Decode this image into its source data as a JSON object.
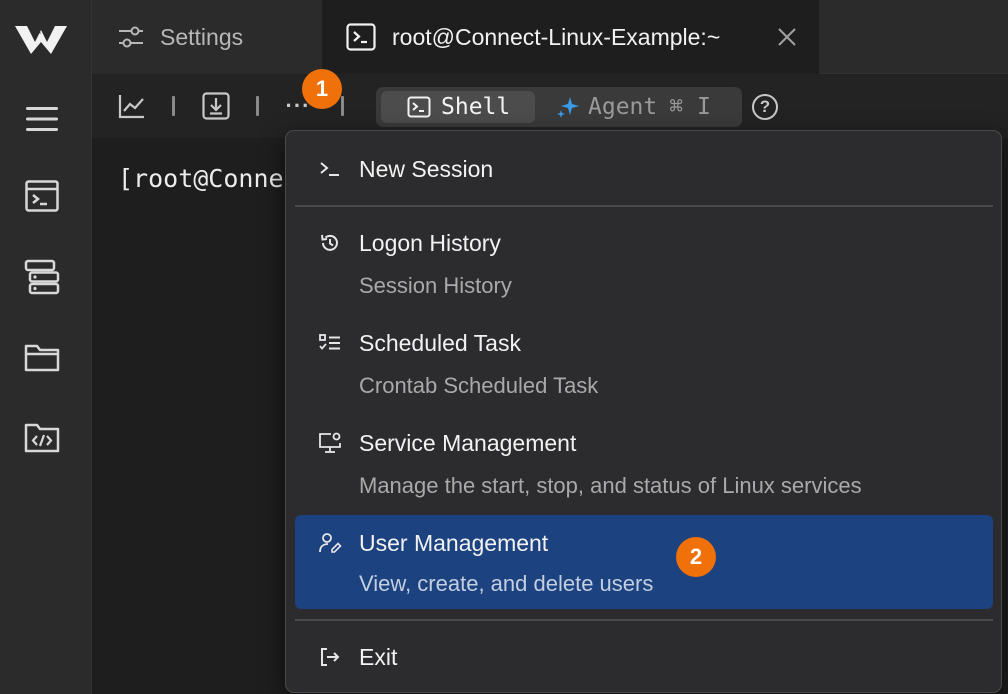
{
  "tabs": {
    "settings_label": "Settings",
    "terminal_label": "root@Connect-Linux-Example:~",
    "close_icon": "close-icon"
  },
  "rail": {
    "icons": [
      "app-logo",
      "hamburger-menu-icon",
      "terminal-icon",
      "servers-icon",
      "folder-icon",
      "code-folder-icon"
    ]
  },
  "toolbar": {
    "shell_label": "Shell",
    "agent_label": "Agent",
    "agent_shortcut": "⌘ I",
    "help_label": "?",
    "more_label": "···"
  },
  "terminal": {
    "line": "[root@Conne"
  },
  "badges": {
    "step1": "1",
    "step2": "2"
  },
  "menu": {
    "items": [
      {
        "label": "New Session",
        "desc": "",
        "icon": "terminal-prompt-icon"
      },
      {
        "label": "Logon History",
        "desc": "Session History",
        "icon": "history-icon"
      },
      {
        "label": "Scheduled Task",
        "desc": "Crontab Scheduled Task",
        "icon": "task-list-icon"
      },
      {
        "label": "Service Management",
        "desc": "Manage the start, stop, and status of Linux services",
        "icon": "monitor-gear-icon"
      },
      {
        "label": "User Management",
        "desc": "View, create, and delete users",
        "icon": "user-edit-icon",
        "active": true
      },
      {
        "label": "Exit",
        "desc": "",
        "icon": "exit-icon"
      }
    ]
  },
  "colors": {
    "background": "#1e1e1e",
    "rail": "#2b2b2b",
    "menu_bg": "#2c2c2e",
    "active_item": "#1c4280",
    "badge": "#f0700a",
    "agent_accent": "#3b9be8"
  }
}
